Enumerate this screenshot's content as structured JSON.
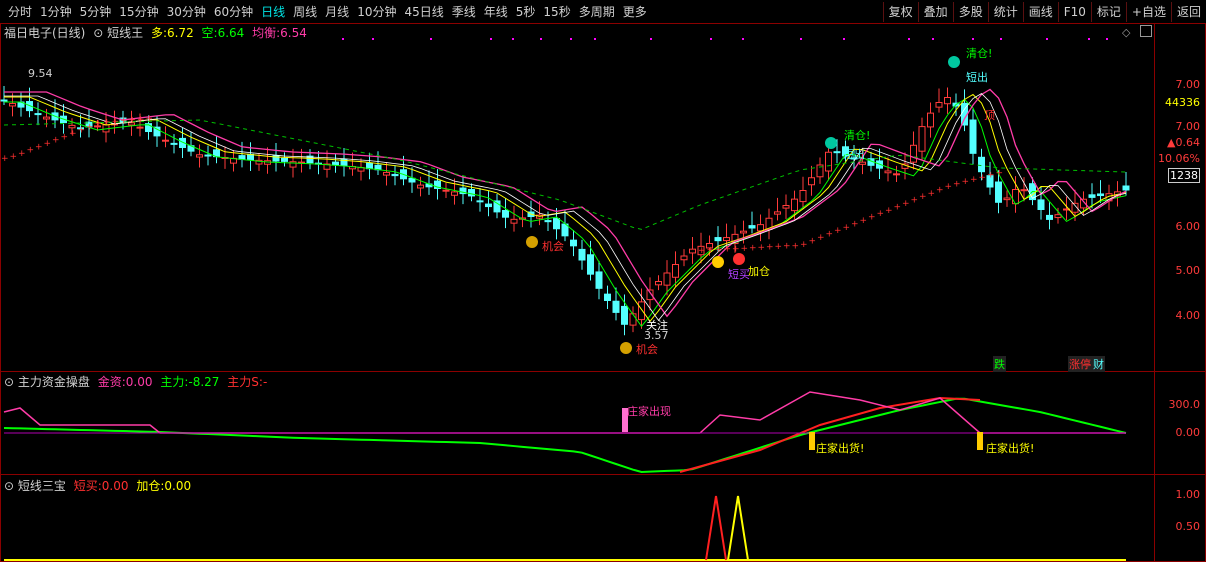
{
  "toolbar": {
    "left": [
      {
        "label": "分时"
      },
      {
        "label": "1分钟"
      },
      {
        "label": "5分钟"
      },
      {
        "label": "15分钟"
      },
      {
        "label": "30分钟"
      },
      {
        "label": "60分钟"
      },
      {
        "label": "日线",
        "active": true
      },
      {
        "label": "周线"
      },
      {
        "label": "月线"
      },
      {
        "label": "10分钟"
      },
      {
        "label": "45日线"
      },
      {
        "label": "季线"
      },
      {
        "label": "年线"
      },
      {
        "label": "5秒"
      },
      {
        "label": "15秒"
      },
      {
        "label": "多周期"
      },
      {
        "label": "更多"
      }
    ],
    "right": [
      {
        "label": "复权"
      },
      {
        "label": "叠加"
      },
      {
        "label": "多股"
      },
      {
        "label": "统计"
      },
      {
        "label": "画线"
      },
      {
        "label": "F10"
      },
      {
        "label": "标记"
      },
      {
        "label": "+自选"
      },
      {
        "label": "返回"
      }
    ]
  },
  "main_panel": {
    "stock_name": "福日电子(日线)",
    "indicator": "短线王",
    "duo_label": "多:",
    "duo_value": "6.72",
    "kong_label": "空:",
    "kong_value": "6.64",
    "junheng_label": "均衡:",
    "junheng_value": "6.54",
    "high_marker": "9.54",
    "y_axis": [
      "7.00",
      "44336",
      "7.00",
      "▲0.64",
      "10.06%",
      "1238",
      "6.00",
      "5.00",
      "4.00"
    ],
    "annotations": {
      "qingcang1": "清仓!",
      "duanchu1": "短出",
      "ding": "顶",
      "qingcang2": "清仓!",
      "duanchu2": "短出",
      "jihui1": "机会",
      "jihui2": "机会",
      "guanzhu": "关注",
      "low_price": "3.57",
      "jiacang": "加仓",
      "duanmai": "短买",
      "die": "跌",
      "zhangting": "涨停",
      "cai": "财"
    }
  },
  "panel2": {
    "title": "主力资金操盘",
    "jinzi_label": "金资:",
    "jinzi_value": "0.00",
    "zhuli_label": "主力:",
    "zhuli_value": "-8.27",
    "zhulis_label": "主力S:",
    "zhulis_value": "-",
    "y_axis": [
      "300.0",
      "0.00"
    ],
    "ann_zhuangjia_chuxian": "庄家出现",
    "ann_chuhuo1": "庄家出货!",
    "ann_chuhuo2": "庄家出货!"
  },
  "panel3": {
    "title": "短线三宝",
    "duanmai_label": "短买:",
    "duanmai_value": "0.00",
    "jiacang_label": "加仓:",
    "jiacang_value": "0.00",
    "y_axis": [
      "1.00",
      "0.50"
    ]
  },
  "colors": {
    "up": "#ff3b3b",
    "down": "#54ffff",
    "ma_green": "#00ff00",
    "ma_yellow": "#ffff00",
    "ma_pink": "#ff3ca8",
    "ma_gray": "#ffffff",
    "dotted": "#00c000",
    "cross": "#ff3030",
    "magenta": "#ff00ff",
    "border": "#8b0000"
  }
}
